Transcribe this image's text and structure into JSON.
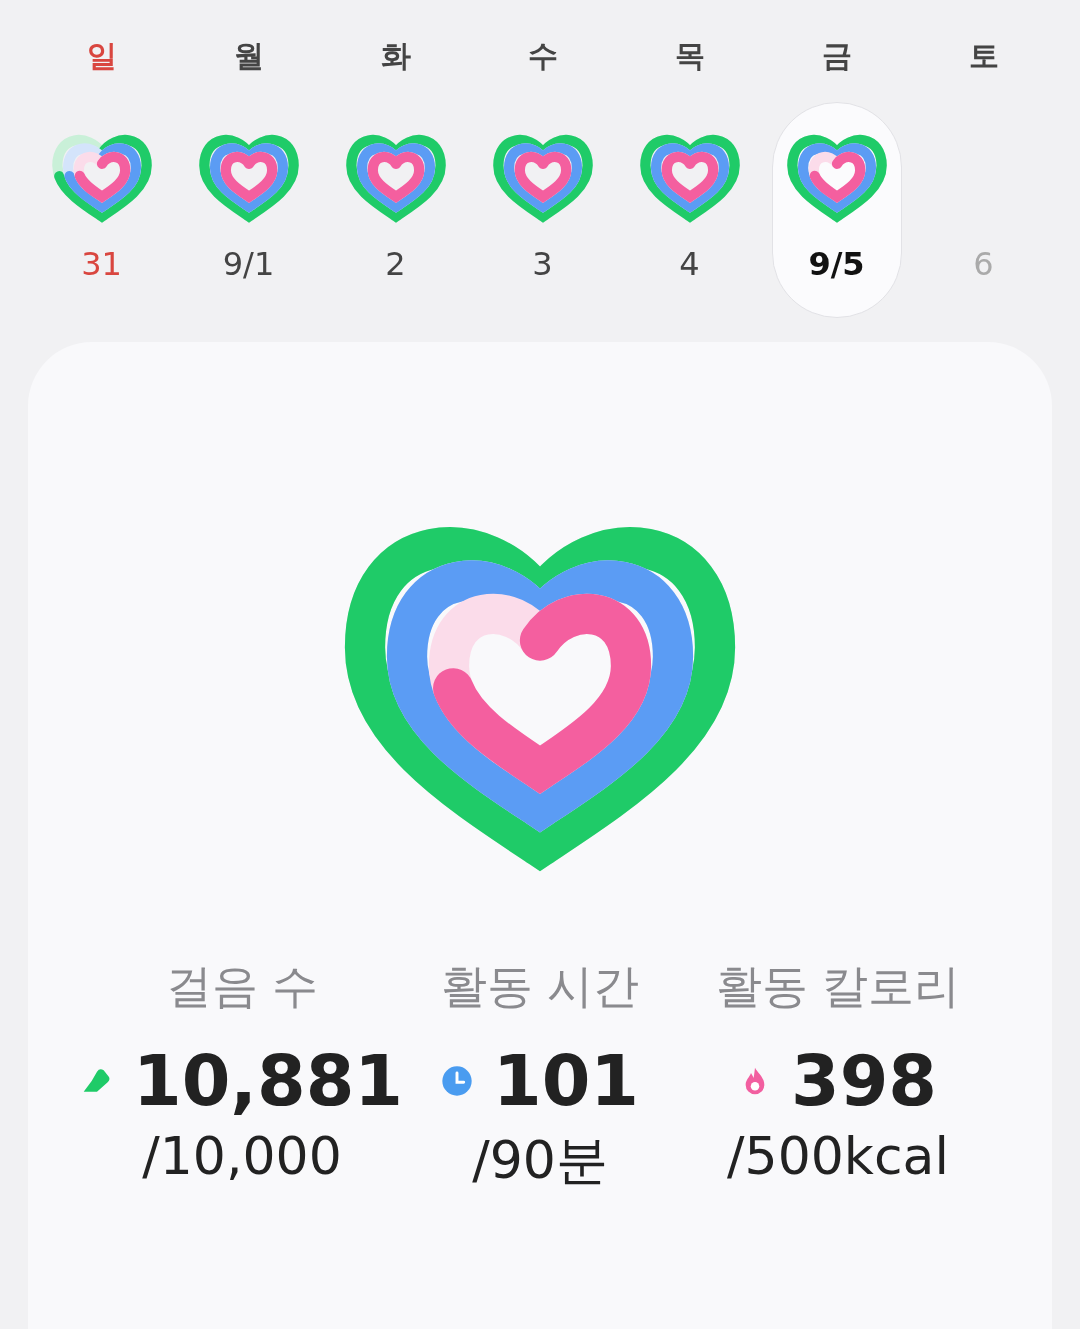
{
  "days": [
    {
      "weekday": "일",
      "date": "31",
      "kind": "sunday",
      "selected": false,
      "rings": [
        {
          "kind": "steps",
          "complete": false
        },
        {
          "kind": "time",
          "complete": false
        },
        {
          "kind": "calories",
          "complete": false
        }
      ]
    },
    {
      "weekday": "월",
      "date": "9/1",
      "kind": "weekday",
      "selected": false,
      "rings": [
        {
          "kind": "steps",
          "complete": true
        },
        {
          "kind": "time",
          "complete": true
        },
        {
          "kind": "calories",
          "complete": true
        }
      ]
    },
    {
      "weekday": "화",
      "date": "2",
      "kind": "weekday",
      "selected": false,
      "rings": [
        {
          "kind": "steps",
          "complete": true
        },
        {
          "kind": "time",
          "complete": true
        },
        {
          "kind": "calories",
          "complete": true
        }
      ]
    },
    {
      "weekday": "수",
      "date": "3",
      "kind": "weekday",
      "selected": false,
      "rings": [
        {
          "kind": "steps",
          "complete": true
        },
        {
          "kind": "time",
          "complete": true
        },
        {
          "kind": "calories",
          "complete": true
        }
      ]
    },
    {
      "weekday": "목",
      "date": "4",
      "kind": "weekday",
      "selected": false,
      "rings": [
        {
          "kind": "steps",
          "complete": true
        },
        {
          "kind": "time",
          "complete": true
        },
        {
          "kind": "calories",
          "complete": true
        }
      ]
    },
    {
      "weekday": "금",
      "date": "9/5",
      "kind": "weekday",
      "selected": true,
      "rings": [
        {
          "kind": "steps",
          "complete": true
        },
        {
          "kind": "time",
          "complete": true
        },
        {
          "kind": "calories",
          "complete": false
        }
      ]
    },
    {
      "weekday": "토",
      "date": "6",
      "kind": "future",
      "selected": false
    }
  ],
  "summary": {
    "rings": [
      {
        "kind": "steps",
        "complete": true
      },
      {
        "kind": "time",
        "complete": true
      },
      {
        "kind": "calories",
        "complete": false
      }
    ]
  },
  "stats": [
    {
      "kind": "steps",
      "label": "걸음 수",
      "value": "10,881",
      "goal": "/10,000"
    },
    {
      "kind": "time",
      "label": "활동 시간",
      "value": "101",
      "goal": "/90분"
    },
    {
      "kind": "calories",
      "label": "활동 칼로리",
      "value": "398",
      "goal": "/500kcal"
    }
  ]
}
